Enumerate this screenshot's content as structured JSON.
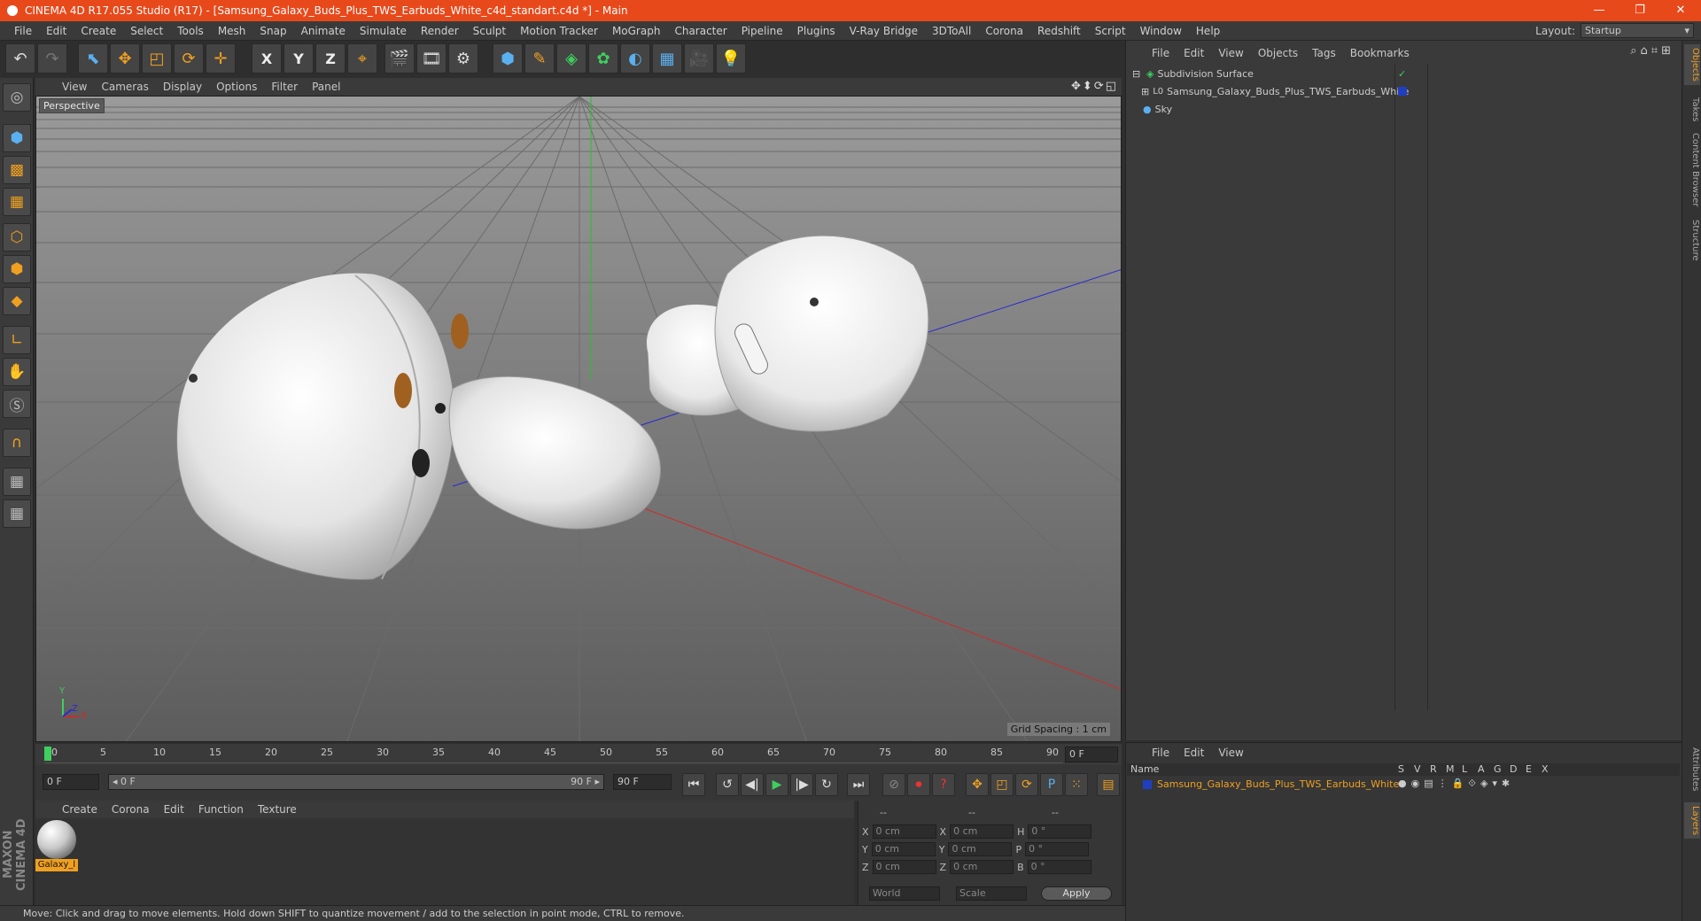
{
  "window": {
    "title": "CINEMA 4D R17.055 Studio (R17) - [Samsung_Galaxy_Buds_Plus_TWS_Earbuds_White_c4d_standart.c4d *] - Main",
    "minimize": "—",
    "restore": "❐",
    "close": "✕"
  },
  "menu": {
    "items": [
      "File",
      "Edit",
      "Create",
      "Select",
      "Tools",
      "Mesh",
      "Snap",
      "Animate",
      "Simulate",
      "Render",
      "Sculpt",
      "Motion Tracker",
      "MoGraph",
      "Character",
      "Pipeline",
      "Plugins",
      "V-Ray Bridge",
      "3DToAll",
      "Corona",
      "Redshift",
      "Script",
      "Window",
      "Help"
    ],
    "layout_label": "Layout:",
    "layout_value": "Startup"
  },
  "toolbar": {
    "undo": "↶",
    "redo": "↷",
    "select": "⬉",
    "move": "✥",
    "scale": "◰",
    "rotate": "⟳",
    "last_tool": "✛",
    "x": "X",
    "y": "Y",
    "z": "Z",
    "coord": "⌖",
    "render_view": "🎬",
    "render_pic": "🎞",
    "render_settings": "⚙",
    "cube": "⬢",
    "pen": "✎",
    "subdiv": "◈",
    "array": "✿",
    "deformer": "◐",
    "floor": "▦",
    "camera": "🎥",
    "light": "💡"
  },
  "viewport": {
    "menu": [
      "View",
      "Cameras",
      "Display",
      "Options",
      "Filter",
      "Panel"
    ],
    "nav_icons": "✥⬍⟳◱",
    "label": "Perspective",
    "grid_spacing": "Grid Spacing : 1 cm",
    "axis_y": "Y",
    "axis_x": "X",
    "axis_z": "Z"
  },
  "timeline": {
    "ticks": [
      "0",
      "5",
      "10",
      "15",
      "20",
      "25",
      "30",
      "35",
      "40",
      "45",
      "50",
      "55",
      "60",
      "65",
      "70",
      "75",
      "80",
      "85",
      "90"
    ],
    "frame_display": "0 F",
    "start_frame": "0 F",
    "range_start": "◂ 0 F",
    "range_end": "90 F ▸",
    "end_frame": "90 F"
  },
  "playback": {
    "first": "⏮",
    "prev_key": "↺",
    "prev_frame": "◀|",
    "play": "▶",
    "next_frame": "|▶",
    "next_key": "↻",
    "last": "⏭",
    "keys": [
      "⊘",
      "⏺",
      "?"
    ],
    "modes": [
      "✥",
      "◰",
      "⟳",
      "P",
      "⁙"
    ],
    "timeline_btn": "▤"
  },
  "materials": {
    "menu": [
      "Create",
      "Corona",
      "Edit",
      "Function",
      "Texture"
    ],
    "material_name": "Galaxy_l"
  },
  "coordinates": {
    "header": [
      "--",
      "--",
      "--"
    ],
    "rows": [
      {
        "a": "X",
        "av": "0 cm",
        "b": "X",
        "bv": "0 cm",
        "c": "H",
        "cv": "0 °"
      },
      {
        "a": "Y",
        "av": "0 cm",
        "b": "Y",
        "bv": "0 cm",
        "c": "P",
        "cv": "0 °"
      },
      {
        "a": "Z",
        "av": "0 cm",
        "b": "Z",
        "bv": "0 cm",
        "c": "B",
        "cv": "0 °"
      }
    ],
    "world": "World",
    "scale": "Scale",
    "apply": "Apply"
  },
  "objects": {
    "menu": [
      "File",
      "Edit",
      "View",
      "Objects",
      "Tags",
      "Bookmarks"
    ],
    "icons": "⌕⌂⌗⊞",
    "items": [
      {
        "name": "Subdivision Surface",
        "icon": "◈",
        "color": "#3fcf5f"
      },
      {
        "name": "Samsung_Galaxy_Buds_Plus_TWS_Earbuds_White",
        "icon": "L0",
        "color": "#c8c8c8"
      },
      {
        "name": "Sky",
        "icon": "●",
        "color": "#5ab0f0"
      }
    ]
  },
  "layers": {
    "menu": [
      "File",
      "Edit",
      "View"
    ],
    "columns": [
      "Name",
      "S",
      "V",
      "R",
      "M",
      "L",
      "A",
      "G",
      "D",
      "E",
      "X"
    ],
    "row_name": "Samsung_Galaxy_Buds_Plus_TWS_Earbuds_White",
    "row_color": "#1f3fbf"
  },
  "right_tabs": [
    "Objects",
    "Takes",
    "Content Browser",
    "Structure",
    "Attributes",
    "Layers"
  ],
  "status": "Move: Click and drag to move elements. Hold down SHIFT to quantize movement / add to the selection in point mode, CTRL to remove.",
  "brand": "MAXON CINEMA 4D",
  "colors": {
    "title_bar": "#e8491b",
    "accent": "#f0a020",
    "panel": "#3a3a3a"
  }
}
